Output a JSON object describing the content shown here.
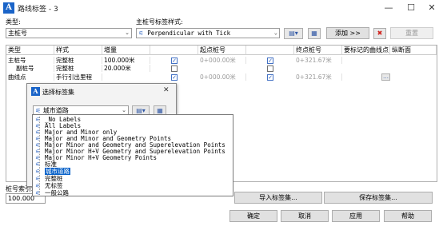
{
  "window": {
    "title": "路线标签 - 3",
    "logo": "A",
    "minimize": "—",
    "maximize": "☐",
    "close": "✕"
  },
  "top": {
    "type_label": "类型:",
    "type_value": "主桩号",
    "style_label": "主桩号标签样式:",
    "style_value": "Perpendicular with Tick",
    "add_button": "添加 >>",
    "delete_icon": "✖",
    "reset_button": "重置"
  },
  "grid": {
    "headers": [
      "类型",
      "样式",
      "增量",
      "",
      "起点桩号",
      "",
      "终点桩号",
      "要标记的曲线点",
      "纵断面"
    ],
    "rows": [
      {
        "type": "主桩号",
        "style": "完整桩",
        "increment": "100.000米",
        "chk1": true,
        "start": "0+000.00米",
        "chk2": true,
        "end": "0+321.67米",
        "extra": ""
      },
      {
        "type": "副桩号",
        "style": "完整桩",
        "increment": "20.000米",
        "chk1": false,
        "start": "",
        "chk2": false,
        "end": "",
        "extra": ""
      },
      {
        "type": "曲线点",
        "style": "手行引出里程",
        "increment": "",
        "chk1": true,
        "start": "0+000.00米",
        "chk2": true,
        "end": "0+321.67米",
        "extra": "…"
      }
    ]
  },
  "bottom": {
    "station_index_label": "桩号索引增量:",
    "station_index_value": "100.000",
    "import_button": "导入标签集...",
    "save_button": "保存标签集...",
    "ok_button": "确定",
    "cancel_button": "取消",
    "apply_button": "应用",
    "help_button": "帮助"
  },
  "dialog": {
    "title": "选择标签集",
    "logo": "A",
    "close": "✕",
    "combo_value": "城市道路",
    "items": [
      "_No Labels",
      "All Labels",
      "Major and Minor only",
      "Major and Minor and Geometry Points",
      "Major Minor and Geometry and Superelevation Points",
      "Major Minor H+V Geometry and Superelevation Points",
      "Major Minor H+V Geometry Points",
      "标准",
      "城市道路",
      "完整桩",
      "无标签",
      "一般公路"
    ],
    "selected_item": "城市道路"
  },
  "colors": {
    "accent": "#0a63c9",
    "delete": "#d0201a"
  }
}
